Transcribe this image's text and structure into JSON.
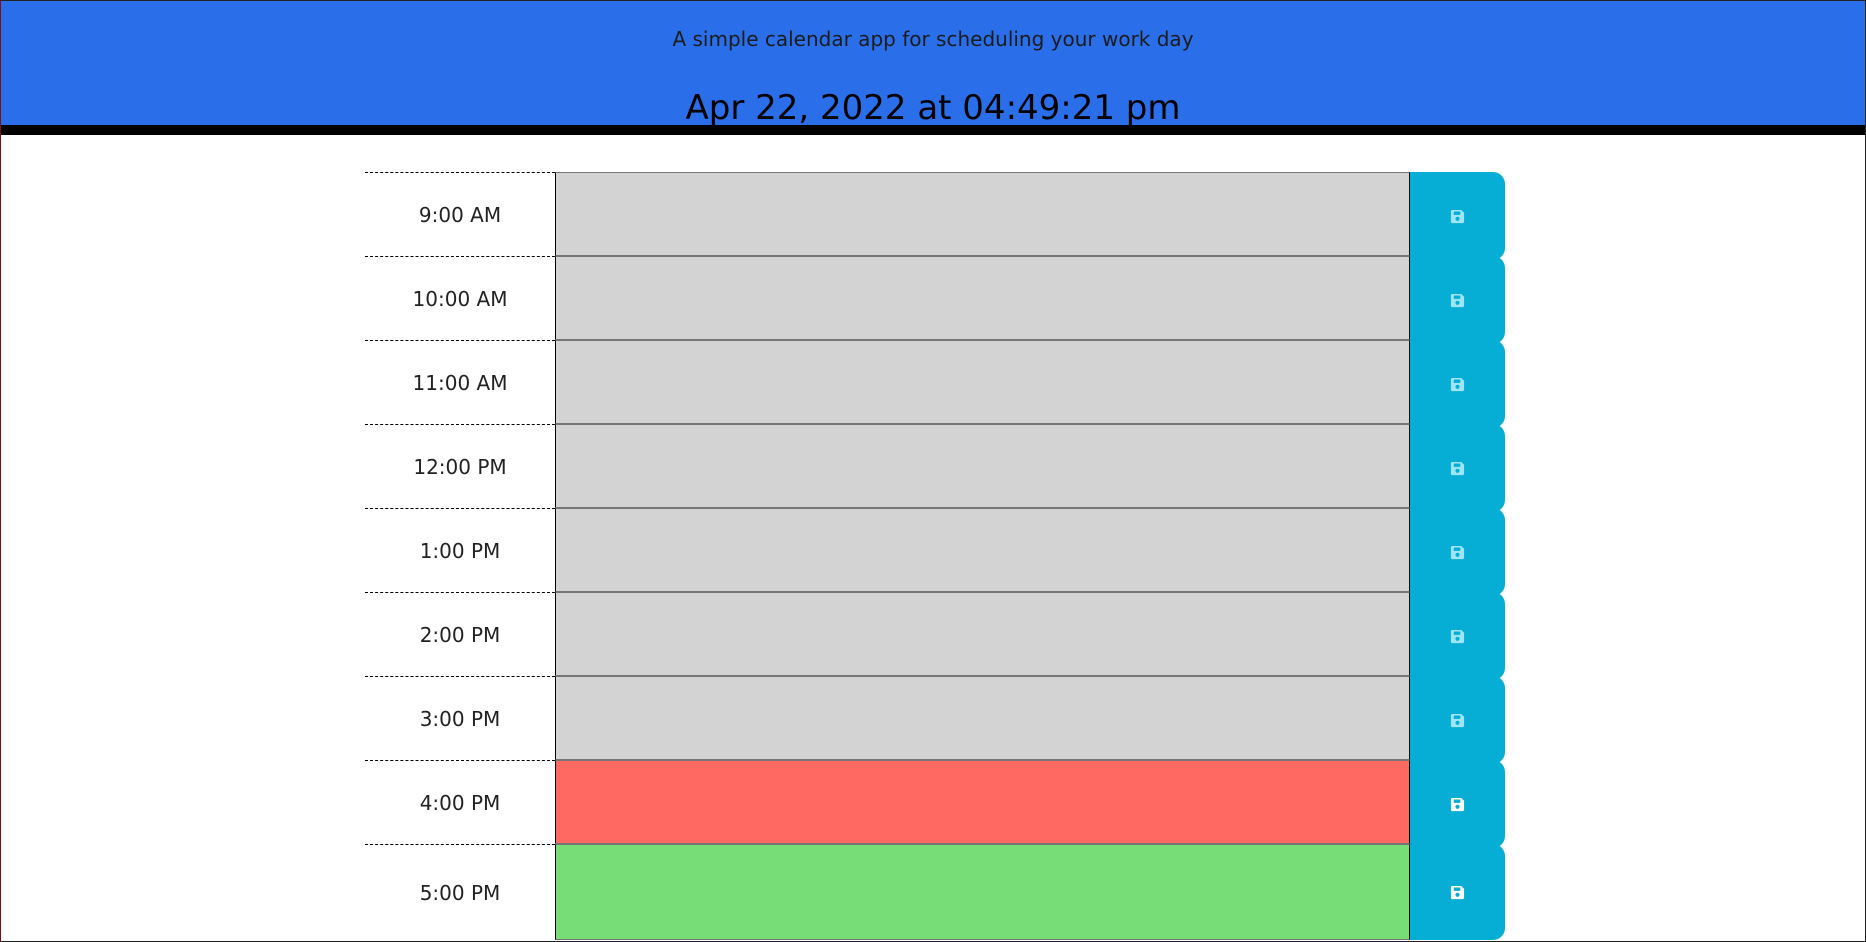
{
  "header": {
    "subtitle": "A simple calendar app for scheduling your work day",
    "datetime": "Apr 22, 2022 at 04:49:21 pm"
  },
  "colors": {
    "header_bg": "#2a6eea",
    "past": "#d3d3d3",
    "present": "#ff6961",
    "future": "#77dd77",
    "save_button": "#06aed5"
  },
  "time_blocks": [
    {
      "hour": "9:00 AM",
      "state": "past",
      "text": "",
      "save_icon": "floppy-disk-icon"
    },
    {
      "hour": "10:00 AM",
      "state": "past",
      "text": "",
      "save_icon": "floppy-disk-icon"
    },
    {
      "hour": "11:00 AM",
      "state": "past",
      "text": "",
      "save_icon": "floppy-disk-icon"
    },
    {
      "hour": "12:00 PM",
      "state": "past",
      "text": "",
      "save_icon": "floppy-disk-icon"
    },
    {
      "hour": "1:00 PM",
      "state": "past",
      "text": "",
      "save_icon": "floppy-disk-icon"
    },
    {
      "hour": "2:00 PM",
      "state": "past",
      "text": "",
      "save_icon": "floppy-disk-icon"
    },
    {
      "hour": "3:00 PM",
      "state": "past",
      "text": "",
      "save_icon": "floppy-disk-icon"
    },
    {
      "hour": "4:00 PM",
      "state": "present",
      "text": "",
      "save_icon": "floppy-disk-icon"
    },
    {
      "hour": "5:00 PM",
      "state": "future",
      "text": "",
      "save_icon": "floppy-disk-icon"
    }
  ]
}
